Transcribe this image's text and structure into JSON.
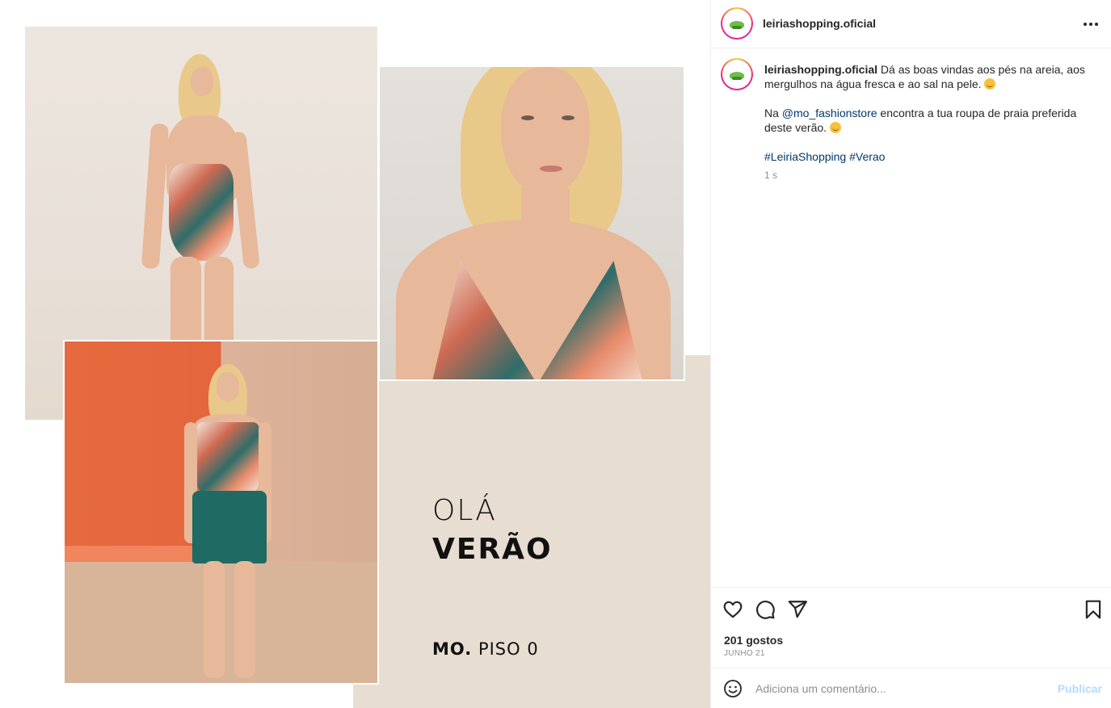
{
  "post": {
    "author": "leiriashopping.oficial",
    "collage": {
      "line1": "OLÁ",
      "line2": "VERÃO",
      "store_brand": "MO.",
      "store_floor": "PISO 0"
    }
  },
  "caption": {
    "username": "leiriashopping.oficial",
    "text1": "Dá as boas vindas aos pés na areia, aos mergulhos na água fresca e ao sal na pele.",
    "text2_prefix": "Na",
    "mention": "@mo_fashionstore",
    "text2_suffix": "encontra a tua roupa de praia preferida deste verão.",
    "hashtag1": "#LeiriaShopping",
    "hashtag2": "#Verao",
    "time": "1 s"
  },
  "stats": {
    "likes": "201 gostos",
    "date": "JUNHO 21"
  },
  "comment": {
    "placeholder": "Adiciona um comentário...",
    "publish_label": "Publicar"
  },
  "icons": {
    "more": "more-horizontal-icon",
    "like": "heart-icon",
    "comment": "comment-icon",
    "share": "send-icon",
    "save": "bookmark-icon",
    "emoji": "smile-icon"
  },
  "colors": {
    "link": "#00376b",
    "muted": "#8e8e8e",
    "publish_disabled": "#b3dbff",
    "beige": "#e7ddd1"
  }
}
